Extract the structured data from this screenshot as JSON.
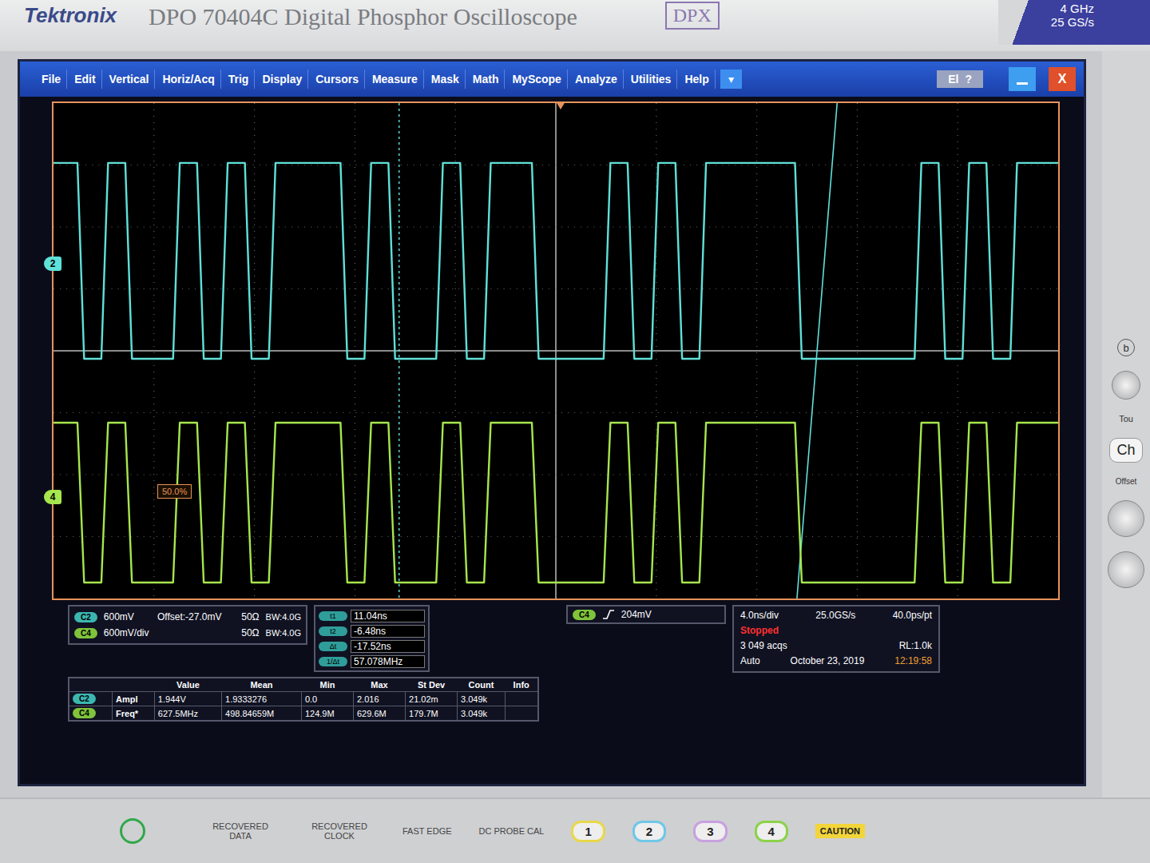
{
  "brand": "Tektronix",
  "model": "DPO 70404C Digital Phosphor Oscilloscope",
  "badge": "DPX",
  "specs": [
    "4 GHz",
    "25 GS/s"
  ],
  "menu": [
    {
      "label": "File"
    },
    {
      "label": "Edit"
    },
    {
      "label": "Vertical"
    },
    {
      "label": "Horiz/Acq"
    },
    {
      "label": "Trig"
    },
    {
      "label": "Display"
    },
    {
      "label": "Cursors"
    },
    {
      "label": "Measure"
    },
    {
      "label": "Mask"
    },
    {
      "label": "Math"
    },
    {
      "label": "MyScope"
    },
    {
      "label": "Analyze"
    },
    {
      "label": "Utilities"
    },
    {
      "label": "Help"
    }
  ],
  "menu_dropdown": "▾",
  "status_icons": [
    "El",
    "?"
  ],
  "close_button": "X",
  "trigger_level_label": "50.0%",
  "series": [
    {
      "name": "C2",
      "marker": "2",
      "color": "#5fe0d8",
      "values": [
        1.9,
        0,
        1.9,
        0,
        0,
        1.9,
        0,
        1.9,
        0,
        1.9,
        1.9,
        1.9,
        0,
        1.9,
        0,
        0,
        1.9,
        0,
        1.9,
        1.9,
        0,
        0,
        0,
        1.9,
        0,
        1.9,
        0,
        1.9,
        1.9,
        1.9,
        1.9,
        0,
        0,
        0,
        0,
        0,
        1.9,
        0,
        1.9,
        0,
        1.9,
        1.9
      ]
    },
    {
      "name": "C4",
      "marker": "4",
      "color": "#a6e64e",
      "values": [
        1.55,
        0,
        1.55,
        0,
        0,
        1.55,
        0,
        1.55,
        0,
        1.55,
        1.55,
        1.55,
        0,
        1.55,
        0,
        0,
        1.55,
        0,
        1.55,
        1.55,
        0,
        0,
        0,
        1.55,
        0,
        1.55,
        0,
        1.55,
        1.55,
        1.55,
        1.55,
        0,
        0,
        0,
        0,
        0,
        1.55,
        0,
        1.55,
        0,
        1.55,
        1.55
      ]
    }
  ],
  "channels": [
    {
      "name": "C2",
      "scale": "600mV",
      "offset": "Offset:-27.0mV",
      "impedance": "50Ω",
      "bandwidth": "BW:4.0G",
      "color": "#3bb7b0"
    },
    {
      "name": "C4",
      "scale": "600mV/div",
      "offset": "",
      "impedance": "50Ω",
      "bandwidth": "BW:4.0G",
      "color": "#7fc43a"
    }
  ],
  "cursors": [
    {
      "label": "t1",
      "value": "11.04ns"
    },
    {
      "label": "t2",
      "value": "-6.48ns"
    },
    {
      "label": "Δt",
      "value": "-17.52ns"
    },
    {
      "label": "1/Δt",
      "value": "57.078MHz"
    }
  ],
  "trigger": {
    "source": "C4",
    "level": "204mV"
  },
  "acquisition": {
    "timebase": "4.0ns/div",
    "rate": "25.0GS/s",
    "resolution": "40.0ps/pt",
    "state": "Stopped",
    "acqs": "3 049 acqs",
    "record": "RL:1.0k",
    "mode": "Auto",
    "date": "October 23, 2019",
    "time": "12:19:58"
  },
  "measurements": {
    "columns": [
      "Value",
      "Mean",
      "Min",
      "Max",
      "St Dev",
      "Count",
      "Info"
    ],
    "rows": [
      {
        "source": "C2",
        "name": "Ampl",
        "color": "#3bb7b0",
        "cells": [
          "1.944V",
          "1.9333276",
          "0.0",
          "2.016",
          "21.02m",
          "3.049k",
          ""
        ]
      },
      {
        "source": "C4",
        "name": "Freq*",
        "color": "#7fc43a",
        "cells": [
          "627.5MHz",
          "498.84659M",
          "124.9M",
          "629.6M",
          "179.7M",
          "3.049k",
          ""
        ]
      }
    ]
  },
  "front_panel": {
    "side_labels": [
      "b",
      "Tou",
      "Ch",
      "Offset"
    ],
    "connectors": [
      "RECOVERED DATA",
      "RECOVERED CLOCK",
      "FAST EDGE",
      "DC PROBE CAL"
    ],
    "channel_buttons": [
      {
        "label": "1",
        "color": "#e8d84a"
      },
      {
        "label": "2",
        "color": "#6fc7e8"
      },
      {
        "label": "3",
        "color": "#c8a0e0"
      },
      {
        "label": "4",
        "color": "#8cd24a"
      }
    ],
    "caution": "CAUTION"
  }
}
